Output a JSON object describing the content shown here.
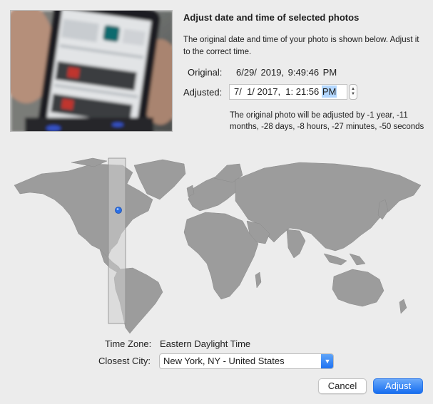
{
  "dialog": {
    "heading": "Adjust date and time of selected photos",
    "intro": "The original date and time of your photo is shown below. Adjust it to the correct time."
  },
  "original": {
    "label": "Original:",
    "value": "6/29/ 2019,  9:49:46 PM"
  },
  "adjusted": {
    "label": "Adjusted:",
    "value_main": "7/  1/ 2017,  1: 21:56 ",
    "value_ampm": "PM"
  },
  "adjustment_note": "The original photo will be adjusted by -1 year, -11 months, -28 days, -8 hours, -27 minutes, -50 seconds",
  "timezone": {
    "label": "Time Zone:",
    "value": "Eastern Daylight Time"
  },
  "city": {
    "label": "Closest City:",
    "value": "New York, NY - United States"
  },
  "buttons": {
    "cancel": "Cancel",
    "adjust": "Adjust"
  },
  "colors": {
    "accent": "#1a6ff2",
    "selection": "#b3d7ff",
    "land": "#9c9c9c",
    "timezone_band": "#cfcfcf",
    "pin": "#2a6fe6"
  },
  "icons": {
    "stepper": "stepper-icon",
    "dropdown": "chevron-down-icon",
    "pin": "location-pin-icon"
  }
}
